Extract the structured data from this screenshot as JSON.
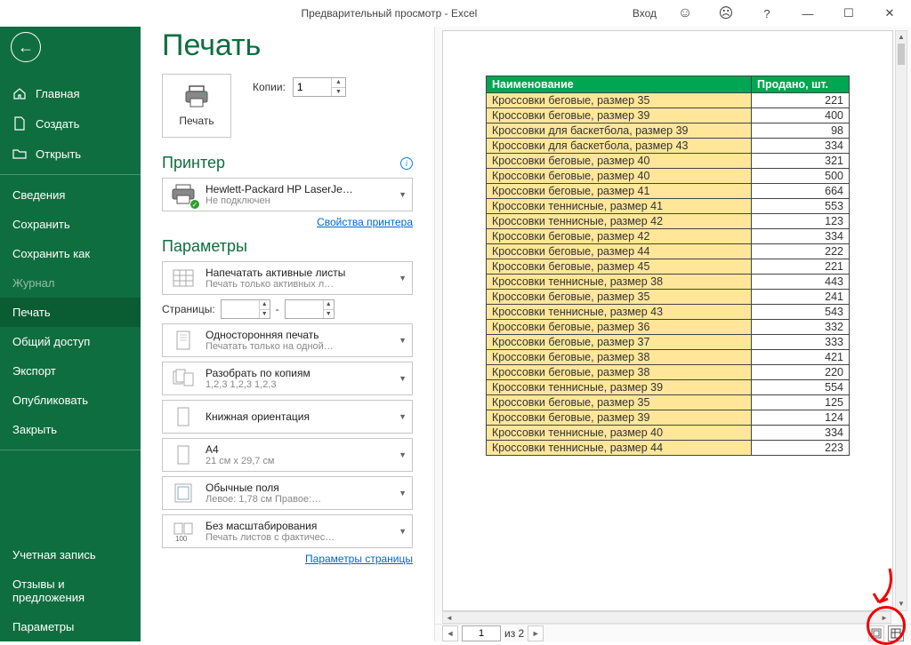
{
  "window": {
    "title": "Предварительный просмотр  -  Excel",
    "login": "Вход"
  },
  "sidebar": {
    "back": "←",
    "items": [
      {
        "label": "Главная",
        "icon": "home"
      },
      {
        "label": "Создать",
        "icon": "new"
      },
      {
        "label": "Открыть",
        "icon": "open"
      }
    ],
    "items2": [
      {
        "label": "Сведения"
      },
      {
        "label": "Сохранить"
      },
      {
        "label": "Сохранить как"
      },
      {
        "label": "Журнал",
        "disabled": true
      },
      {
        "label": "Печать",
        "active": true
      },
      {
        "label": "Общий доступ"
      },
      {
        "label": "Экспорт"
      },
      {
        "label": "Опубликовать"
      },
      {
        "label": "Закрыть"
      }
    ],
    "bottom": [
      {
        "label": "Учетная запись"
      },
      {
        "label": "Отзывы и предложения"
      },
      {
        "label": "Параметры"
      }
    ]
  },
  "print": {
    "title": "Печать",
    "button": "Печать",
    "copies_label": "Копии:",
    "copies_value": "1",
    "printer_section": "Принтер",
    "printer_name": "Hewlett-Packard HP LaserJe…",
    "printer_status": "Не подключен",
    "printer_props": "Свойства принтера",
    "params_section": "Параметры",
    "opt_sheets": "Напечатать активные листы",
    "opt_sheets_sub": "Печать только активных л…",
    "pages_label": "Страницы:",
    "pages_sep": "-",
    "opt_sides": "Односторонняя печать",
    "opt_sides_sub": "Печатать только на одной…",
    "opt_collate": "Разобрать по копиям",
    "opt_collate_sub": "1,2,3    1,2,3    1,2,3",
    "opt_orient": "Книжная ориентация",
    "opt_paper": "A4",
    "opt_paper_sub": "21 см x 29,7 см",
    "opt_margins": "Обычные поля",
    "opt_margins_sub": "Левое:  1,78 см    Правое:…",
    "opt_scale": "Без масштабирования",
    "opt_scale_sub": "Печать листов с фактичес…",
    "page_params": "Параметры страницы"
  },
  "preview": {
    "header_name": "Наименование",
    "header_qty": "Продано, шт.",
    "rows": [
      {
        "name": "Кроссовки беговые, размер 35",
        "qty": "221"
      },
      {
        "name": "Кроссовки беговые, размер 39",
        "qty": "400"
      },
      {
        "name": "Кроссовки для баскетбола, размер 39",
        "qty": "98"
      },
      {
        "name": "Кроссовки для баскетбола, размер 43",
        "qty": "334"
      },
      {
        "name": "Кроссовки беговые, размер 40",
        "qty": "321"
      },
      {
        "name": "Кроссовки беговые, размер 40",
        "qty": "500"
      },
      {
        "name": "Кроссовки беговые, размер 41",
        "qty": "664"
      },
      {
        "name": "Кроссовки теннисные, размер 41",
        "qty": "553"
      },
      {
        "name": "Кроссовки теннисные, размер 42",
        "qty": "123"
      },
      {
        "name": "Кроссовки беговые, размер 42",
        "qty": "334"
      },
      {
        "name": "Кроссовки беговые, размер 44",
        "qty": "222"
      },
      {
        "name": "Кроссовки беговые, размер 45",
        "qty": "221"
      },
      {
        "name": "Кроссовки теннисные, размер 38",
        "qty": "443"
      },
      {
        "name": "Кроссовки беговые, размер 35",
        "qty": "241"
      },
      {
        "name": "Кроссовки теннисные, размер 43",
        "qty": "543"
      },
      {
        "name": "Кроссовки беговые, размер 36",
        "qty": "332"
      },
      {
        "name": "Кроссовки беговые, размер 37",
        "qty": "333"
      },
      {
        "name": "Кроссовки беговые, размер 38",
        "qty": "421"
      },
      {
        "name": "Кроссовки беговые, размер 38",
        "qty": "220"
      },
      {
        "name": "Кроссовки теннисные, размер 39",
        "qty": "554"
      },
      {
        "name": "Кроссовки беговые, размер 35",
        "qty": "125"
      },
      {
        "name": "Кроссовки беговые, размер 39",
        "qty": "124"
      },
      {
        "name": "Кроссовки теннисные, размер 40",
        "qty": "334"
      },
      {
        "name": "Кроссовки теннисные, размер 44",
        "qty": "223"
      }
    ]
  },
  "status": {
    "prev": "◄",
    "page": "1",
    "of": "из 2",
    "next": "►"
  }
}
